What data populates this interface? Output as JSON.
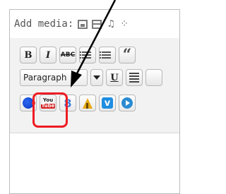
{
  "media": {
    "label": "Add media:",
    "icons": [
      "add-image-icon",
      "add-video-icon",
      "add-audio-icon",
      "more-media-icon"
    ]
  },
  "toolbar": {
    "row1": [
      "B",
      "I",
      "ABC",
      "bullet-list-icon",
      "numbered-list-icon",
      "“"
    ],
    "row2": {
      "format_value": "Paragraph",
      "underline": "U",
      "align": "justify-icon"
    },
    "row3": {
      "plugins": [
        "blue-circle-icon",
        "youtube-icon",
        "google-plus-icon",
        "yellow-triangle-icon",
        "vimeo-icon",
        "play-icon"
      ],
      "youtube": {
        "top": "You",
        "bottom": "Tube"
      },
      "google": "8",
      "vimeo": "v"
    }
  },
  "annotation": {
    "highlight_color": "#ee1c24",
    "arrow_color": "#000000"
  }
}
